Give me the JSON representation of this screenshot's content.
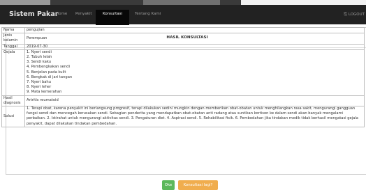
{
  "navbar": {
    "brand": "Sistem Pakar",
    "items": [
      "Home",
      "Penyakit",
      "Konsultasi",
      "Tentang Kami"
    ],
    "active": "Konsultasi",
    "logout": "LOGOUT"
  },
  "panel": {
    "title": "HASIL KONSULTASI"
  },
  "result": {
    "nama_label": "Nama",
    "nama_value": "pengujian",
    "jk_label": "Jenis kelamin",
    "jk_value": "Perempuan",
    "tanggal_label": "Tanggal",
    "tanggal_value": "2019-07-30",
    "gejala_label": "Gejala",
    "gejala": [
      "1. Nyeri sendi",
      "2. Tubuh lelah",
      "3. Sendi kaku",
      "4. Pembengkakan sendi",
      "5. Benjolan pada kulit",
      "6. Bengkak di jari tangan",
      "7. Nyeri bahu",
      "8. Nyeri leher",
      "9. Mata kemerahan"
    ],
    "diagnosis_label": "Hasil diagnosis",
    "diagnosis_value": "Artritis reumatoid",
    "solusi_label": "Solusi",
    "solusi_value": "1. Terapi obat, karena penyakit ini berlangsung progresif, terapi dilakukan sedini mungkin dengan memberikan obat-obatan untuk menghilangkan rasa sakit, mengurangi gangguan fungsi sendi dan mencegah kerusakan sendi. Sebagian penderita yang mendapatkan obat-obatan anti radang atau suntikan kortison ke dalam sendi akan banyak mengalami perbaikan. 2. Istirahat untuk mengurangi aktivitas sendi. 3. Pengaturan diet. 4. Aspirasi sendi. 5. Rehabilitasi fisik. 6. Pembedahan jika tindakan medik tidak berhasil mengatasi gejala penyakit, dapat dilakukan tindakan pembedahan."
  },
  "buttons": {
    "ok": "Oke",
    "again": "Konsultasi lagi?"
  },
  "colors": {
    "navbar": "#222222",
    "ok": "#5cb85c",
    "again": "#f0ad4e"
  }
}
